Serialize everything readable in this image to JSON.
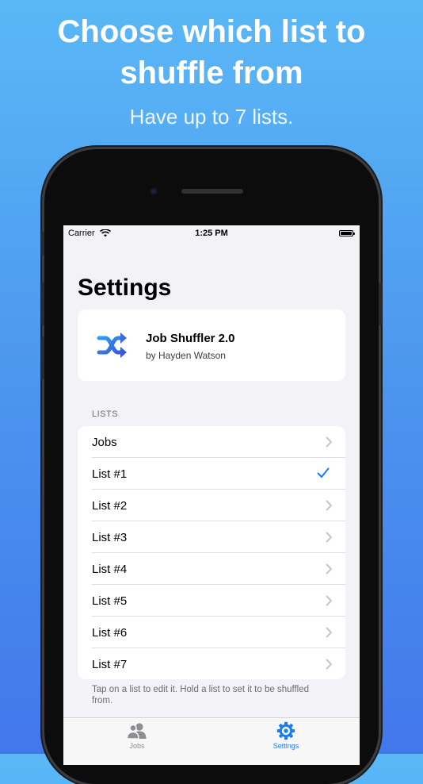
{
  "promo": {
    "headline_line1": "Choose which list to",
    "headline_line2": "shuffle from",
    "subline": "Have up to 7 lists."
  },
  "status_bar": {
    "carrier": "Carrier",
    "time": "1:25 PM"
  },
  "page": {
    "title": "Settings"
  },
  "app_info": {
    "name": "Job Shuffler 2.0",
    "author": "by Hayden Watson",
    "icon": "shuffle-icon",
    "icon_color": "#3b6fe0"
  },
  "lists_section": {
    "header": "LISTS",
    "items": [
      {
        "label": "Jobs",
        "accessory": "chevron"
      },
      {
        "label": "List #1",
        "accessory": "checkmark"
      },
      {
        "label": "List #2",
        "accessory": "chevron"
      },
      {
        "label": "List #3",
        "accessory": "chevron"
      },
      {
        "label": "List #4",
        "accessory": "chevron"
      },
      {
        "label": "List #5",
        "accessory": "chevron"
      },
      {
        "label": "List #6",
        "accessory": "chevron"
      },
      {
        "label": "List #7",
        "accessory": "chevron"
      }
    ],
    "footer": "Tap on a list to edit it. Hold a list to set it to be shuffled from."
  },
  "tab_bar": {
    "tabs": [
      {
        "label": "Jobs",
        "icon": "people-icon",
        "active": false
      },
      {
        "label": "Settings",
        "icon": "gear-icon",
        "active": true
      }
    ],
    "active_color": "#1a7cf0",
    "inactive_color": "#8e8e93"
  }
}
